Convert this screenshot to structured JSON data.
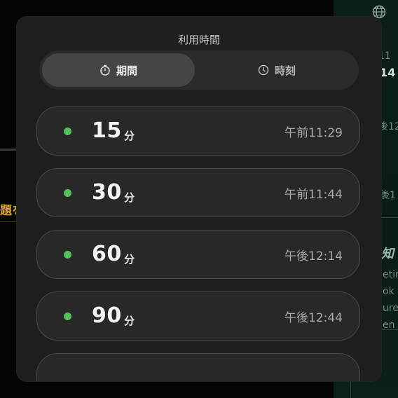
{
  "modal": {
    "title": "利用時間",
    "tabs": [
      {
        "label": "期間",
        "icon": "stopwatch-icon",
        "active": true
      },
      {
        "label": "時刻",
        "icon": "clock-icon",
        "active": false
      }
    ],
    "options": [
      {
        "value": "15",
        "unit": "分",
        "time": "午前11:29"
      },
      {
        "value": "30",
        "unit": "分",
        "time": "午前11:44"
      },
      {
        "value": "60",
        "unit": "分",
        "time": "午後12:14"
      },
      {
        "value": "90",
        "unit": "分",
        "time": "午後12:44"
      },
      {
        "value": "",
        "unit": "",
        "time": ""
      }
    ]
  },
  "background": {
    "fragments": [
      "題を",
      "14",
      "11",
      "後12",
      "後1",
      "知",
      "etir",
      "ok y",
      "ure",
      "en y"
    ]
  },
  "colors": {
    "accent_dot": "#4fc45a",
    "modal_bg": "#1e1e1f",
    "option_bg": "#282829",
    "background_green": "#0b1f19"
  }
}
